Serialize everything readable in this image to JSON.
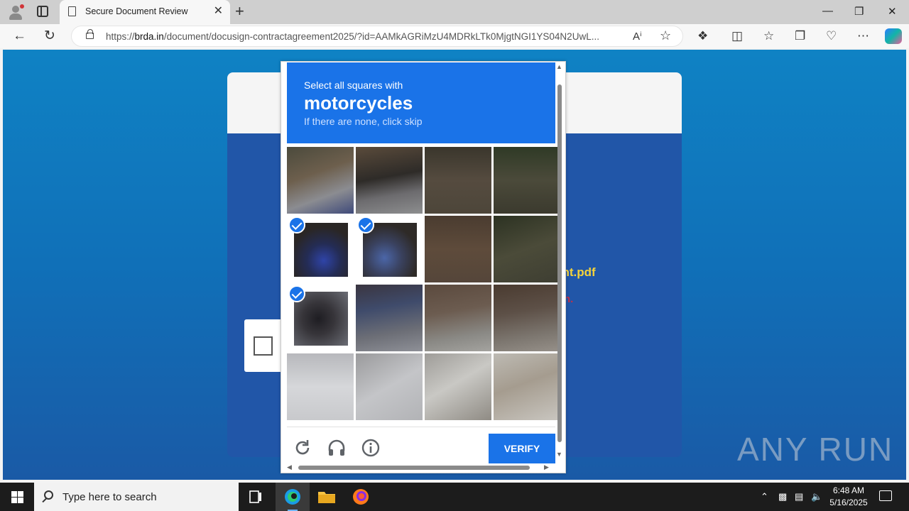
{
  "browser": {
    "tab_title": "Secure Document Review",
    "url_prefix": "https://",
    "url_domain": "brda.in",
    "url_rest": "/document/docusign-contractagreement2025/?id=AAMkAGRiMzU4MDRkLTk0MjgtNGI1YS04N2UwL...",
    "new_tab_label": "+",
    "minimize_label": "—",
    "restore_label": "❐",
    "close_label": "✕",
    "tab_close_label": "✕"
  },
  "page": {
    "file_text": "ent.pdf",
    "red_text": "n."
  },
  "captcha": {
    "instruction": "Select all squares with",
    "target": "motorcycles",
    "hint": "If there are none, click skip",
    "verify_label": "VERIFY",
    "selected_tiles": [
      4,
      5,
      8
    ]
  },
  "watermark": "ANY RUN",
  "taskbar": {
    "search_placeholder": "Type here to search",
    "time": "6:48 AM",
    "date": "5/16/2025"
  },
  "colors": {
    "captcha_blue": "#1a73e8",
    "page_blue": "#1070b8",
    "file_text": "#f5d33a",
    "red_text": "#c0304a"
  },
  "icons": {
    "reload": "reload-icon",
    "audio": "headphones-icon",
    "info": "info-icon"
  }
}
